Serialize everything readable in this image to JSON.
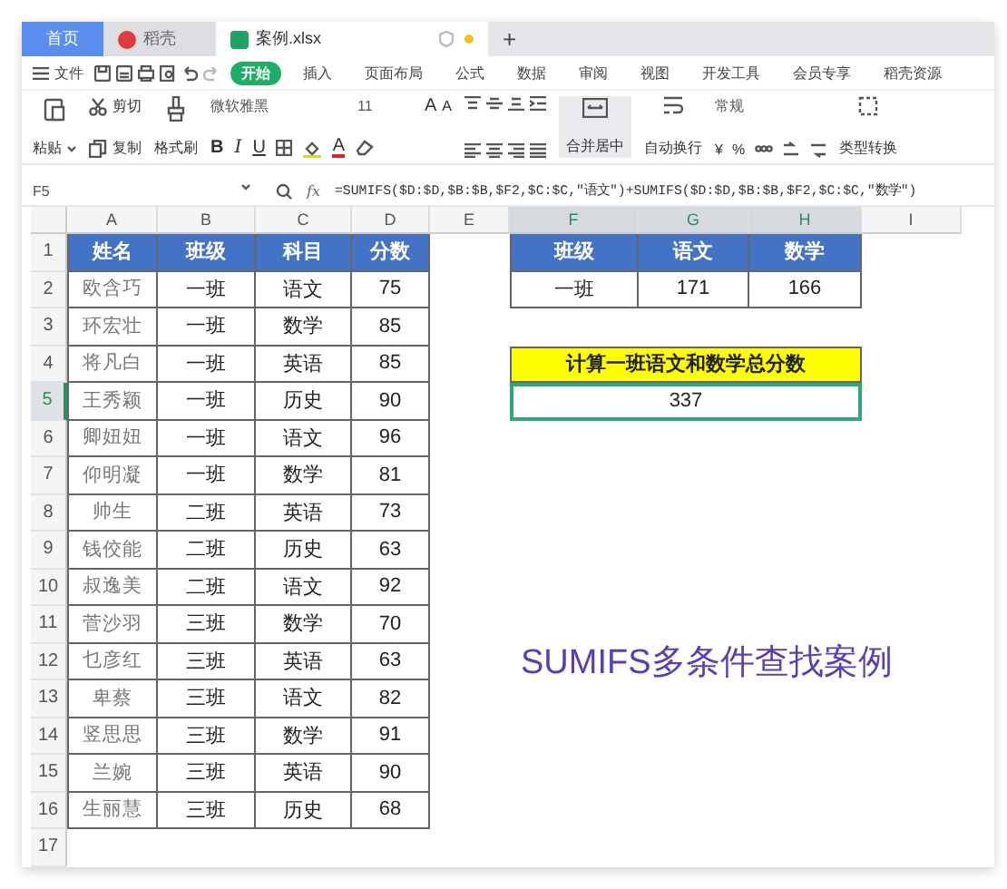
{
  "tabs": [
    {
      "label": "首页",
      "kind": "home",
      "selected": false
    },
    {
      "label": "稻壳",
      "kind": "docer",
      "selected": false
    },
    {
      "label": "案例.xlsx",
      "kind": "sheet",
      "selected": true
    }
  ],
  "new_tab": "+",
  "menu": {
    "file": "文件",
    "items": [
      {
        "label": "开始",
        "selected": true
      },
      {
        "label": "插入",
        "selected": false
      },
      {
        "label": "页面布局",
        "selected": false
      },
      {
        "label": "公式",
        "selected": false
      },
      {
        "label": "数据",
        "selected": false
      },
      {
        "label": "审阅",
        "selected": false
      },
      {
        "label": "视图",
        "selected": false
      },
      {
        "label": "开发工具",
        "selected": false
      },
      {
        "label": "会员专享",
        "selected": false
      },
      {
        "label": "稻壳资源",
        "selected": false
      }
    ]
  },
  "ribbon": {
    "paste": "粘贴",
    "cut": "剪切",
    "copy": "复制",
    "format_painter": "格式刷",
    "font": "微软雅黑",
    "font_size": "11",
    "grow_font": "A",
    "shrink_font": "A",
    "bold": "B",
    "italic": "I",
    "underline": "U",
    "font_color": "A",
    "merge": "合并居中",
    "wrap": "自动换行",
    "number_format": "常规",
    "currency": "¥",
    "percent": "%",
    "convert": "类型转换"
  },
  "formula_bar": {
    "cell": "F5",
    "fx": "fx",
    "formula": "=SUMIFS($D:$D,$B:$B,$F2,$C:$C,\"语文\")+SUMIFS($D:$D,$B:$B,$F2,$C:$C,\"数学\")"
  },
  "sheet": {
    "columns": [
      {
        "label": "A",
        "selected": false
      },
      {
        "label": "B",
        "selected": false
      },
      {
        "label": "C",
        "selected": false
      },
      {
        "label": "D",
        "selected": false
      },
      {
        "label": "E",
        "selected": false
      },
      {
        "label": "F",
        "selected": true
      },
      {
        "label": "G",
        "selected": true
      },
      {
        "label": "H",
        "selected": true
      },
      {
        "label": "I",
        "selected": false
      }
    ],
    "rows": [
      {
        "label": "1",
        "selected": false
      },
      {
        "label": "2",
        "selected": false
      },
      {
        "label": "3",
        "selected": false
      },
      {
        "label": "4",
        "selected": false
      },
      {
        "label": "5",
        "selected": true
      },
      {
        "label": "6",
        "selected": false
      },
      {
        "label": "7",
        "selected": false
      },
      {
        "label": "8",
        "selected": false
      },
      {
        "label": "9",
        "selected": false
      },
      {
        "label": "10",
        "selected": false
      },
      {
        "label": "11",
        "selected": false
      },
      {
        "label": "12",
        "selected": false
      },
      {
        "label": "13",
        "selected": false
      },
      {
        "label": "14",
        "selected": false
      },
      {
        "label": "15",
        "selected": false
      },
      {
        "label": "16",
        "selected": false
      },
      {
        "label": "17",
        "selected": false
      }
    ],
    "score_table": {
      "headers": [
        "姓名",
        "班级",
        "科目",
        "分数"
      ],
      "rows": [
        [
          "欧含巧",
          "一班",
          "语文",
          "75"
        ],
        [
          "环宏壮",
          "一班",
          "数学",
          "85"
        ],
        [
          "将凡白",
          "一班",
          "英语",
          "85"
        ],
        [
          "王秀颖",
          "一班",
          "历史",
          "90"
        ],
        [
          "卿妞妞",
          "一班",
          "语文",
          "96"
        ],
        [
          "仰明凝",
          "一班",
          "数学",
          "81"
        ],
        [
          "帅生",
          "二班",
          "英语",
          "73"
        ],
        [
          "钱佼能",
          "二班",
          "历史",
          "63"
        ],
        [
          "叔逸美",
          "二班",
          "语文",
          "92"
        ],
        [
          "菅沙羽",
          "三班",
          "数学",
          "70"
        ],
        [
          "乜彦红",
          "三班",
          "英语",
          "63"
        ],
        [
          "卑蔡",
          "三班",
          "语文",
          "82"
        ],
        [
          "竖思思",
          "三班",
          "数学",
          "91"
        ],
        [
          "兰婉",
          "三班",
          "英语",
          "90"
        ],
        [
          "生丽慧",
          "三班",
          "历史",
          "68"
        ]
      ]
    },
    "summary_table": {
      "headers": [
        "班级",
        "语文",
        "数学"
      ],
      "rows": [
        [
          "一班",
          "171",
          "166"
        ]
      ]
    },
    "total": {
      "title": "计算一班语文和数学总分数",
      "value": "337",
      "selected": true
    },
    "caption": "SUMIFS多条件查找案例"
  }
}
